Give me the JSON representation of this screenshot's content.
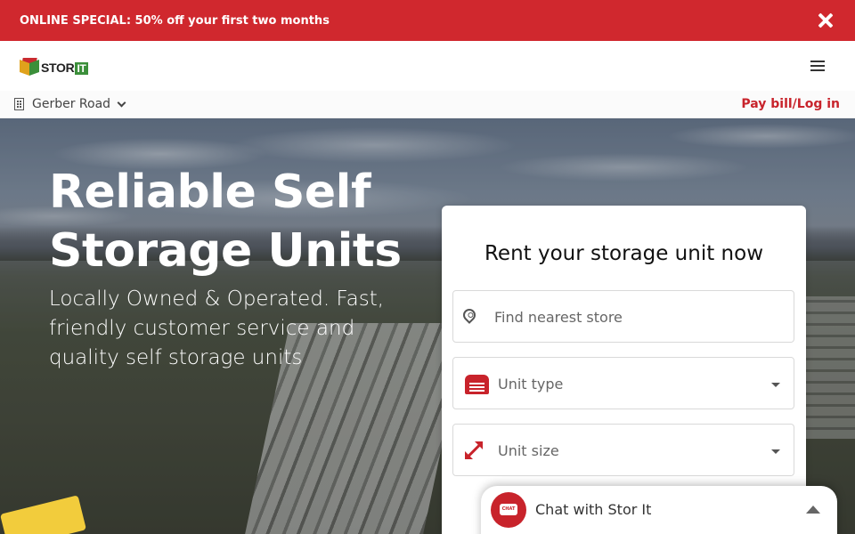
{
  "promo": {
    "text": "ONLINE SPECIAL: 50% off your first two months",
    "close_icon": "close-icon"
  },
  "header": {
    "logo_text": "STOR",
    "logo_text_highlight": "IT",
    "menu_icon": "hamburger-menu-icon"
  },
  "location_bar": {
    "location_icon": "building-icon",
    "selected_location": "Gerber Road",
    "pay_bill_link": "Pay bill/Log in"
  },
  "hero": {
    "title": "Reliable Self Storage Units",
    "subtitle": "Locally Owned & Operated. Fast, friendly customer service and quality self storage units"
  },
  "rent_card": {
    "title": "Rent your storage unit now",
    "store_search_placeholder": "Find nearest store",
    "unit_type_label": "Unit type",
    "unit_size_label": "Unit size"
  },
  "chat": {
    "label": "Chat with Stor It"
  },
  "colors": {
    "brand_red": "#d0282e",
    "accent_red": "#c8232b",
    "logo_green": "#3b8f3a"
  }
}
